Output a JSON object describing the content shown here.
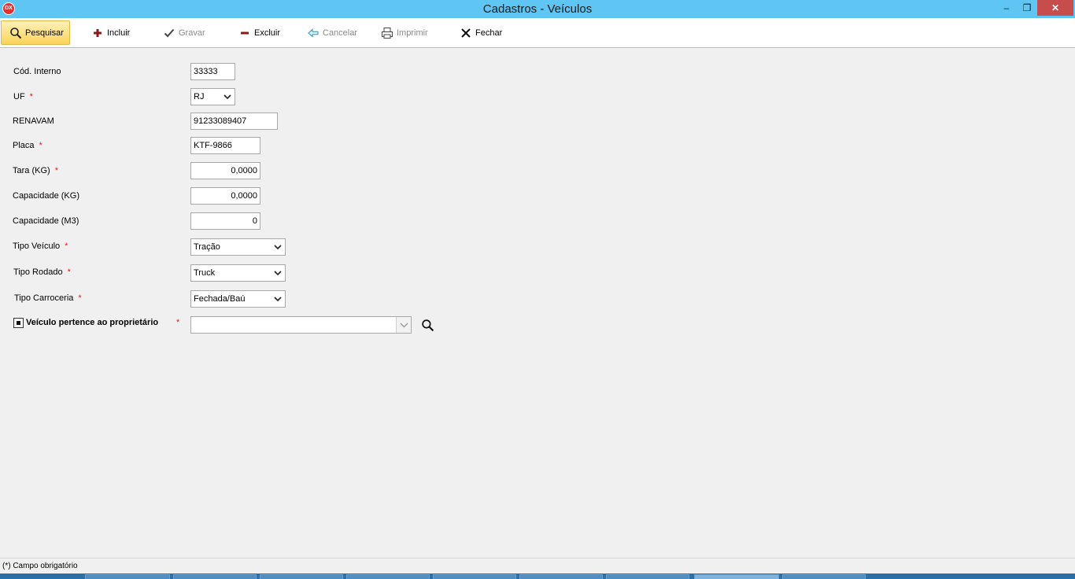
{
  "window": {
    "title": "Cadastros - Veículos",
    "app_icon_text": "DX",
    "minimize_glyph": "–",
    "maximize_glyph": "❐",
    "close_glyph": "✕"
  },
  "toolbar": {
    "pesquisar": {
      "label": "Pesquisar",
      "icon": "search-icon"
    },
    "incluir": {
      "label": "Incluir",
      "icon": "plus-icon"
    },
    "gravar": {
      "label": "Gravar",
      "icon": "check-icon"
    },
    "excluir": {
      "label": "Excluir",
      "icon": "minus-icon"
    },
    "cancelar": {
      "label": "Cancelar",
      "icon": "back-arrow-icon"
    },
    "imprimir": {
      "label": "Imprimir",
      "icon": "printer-icon"
    },
    "fechar": {
      "label": "Fechar",
      "icon": "close-icon"
    }
  },
  "form": {
    "cod_interno": {
      "label": "Cód. Interno",
      "value": "33333"
    },
    "uf": {
      "label": "UF",
      "value": "RJ"
    },
    "renavam": {
      "label": "RENAVAM",
      "value": "91233089407"
    },
    "placa": {
      "label": "Placa",
      "value": "KTF-9866"
    },
    "tara": {
      "label": "Tara (KG)",
      "value": "0,0000"
    },
    "capacidade_kg": {
      "label": "Capacidade (KG)",
      "value": "0,0000"
    },
    "capacidade_m3": {
      "label": "Capacidade (M3)",
      "value": "0"
    },
    "tipo_veiculo": {
      "label": "Tipo Veículo",
      "value": "Tração"
    },
    "tipo_rodado": {
      "label": "Tipo Rodado",
      "value": "Truck"
    },
    "tipo_carroceria": {
      "label": "Tipo Carroceria",
      "value": "Fechada/Baú"
    },
    "proprietario": {
      "label": "Veículo pertence ao proprietário",
      "value": ""
    },
    "required_mark": "*"
  },
  "status": {
    "text": "(*) Campo obrigatório"
  },
  "colors": {
    "titlebar": "#5fc6f3",
    "close": "#c74c4c",
    "required": "#e02020",
    "active_button": "#fbd35b"
  }
}
